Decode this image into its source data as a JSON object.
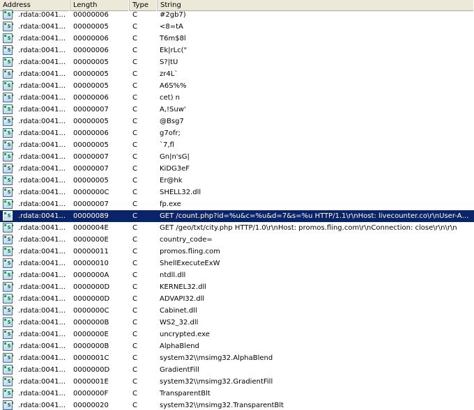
{
  "columns": {
    "address": "Address",
    "length": "Length",
    "type": "Type",
    "string": "String"
  },
  "colors": {
    "header_bg": "#ece9d8",
    "selection_bg": "#0a246a",
    "selection_fg": "#ffffff"
  },
  "icon_name": "string-icon",
  "icon_glyph": "'s'",
  "selected_index": 17,
  "rows": [
    {
      "address": ".rdata:0041...",
      "length": "00000006",
      "type": "C",
      "string": "#2gb7)"
    },
    {
      "address": ".rdata:0041...",
      "length": "00000005",
      "type": "C",
      "string": "<8=tA"
    },
    {
      "address": ".rdata:0041...",
      "length": "00000006",
      "type": "C",
      "string": "T6m$8l"
    },
    {
      "address": ".rdata:0041...",
      "length": "00000006",
      "type": "C",
      "string": "Ek|rLc(\""
    },
    {
      "address": ".rdata:0041...",
      "length": "00000005",
      "type": "C",
      "string": "S?|tU"
    },
    {
      "address": ".rdata:0041...",
      "length": "00000005",
      "type": "C",
      "string": "zr4L`"
    },
    {
      "address": ".rdata:0041...",
      "length": "00000005",
      "type": "C",
      "string": "A6S%%"
    },
    {
      "address": ".rdata:0041...",
      "length": "00000006",
      "type": "C",
      "string": "cet) n"
    },
    {
      "address": ".rdata:0041...",
      "length": "00000007",
      "type": "C",
      "string": "A,!Suw'"
    },
    {
      "address": ".rdata:0041...",
      "length": "00000005",
      "type": "C",
      "string": "@Bsg7"
    },
    {
      "address": ".rdata:0041...",
      "length": "00000006",
      "type": "C",
      "string": "g7ofr;"
    },
    {
      "address": ".rdata:0041...",
      "length": "00000005",
      "type": "C",
      "string": "`7,fl"
    },
    {
      "address": ".rdata:0041...",
      "length": "00000007",
      "type": "C",
      "string": "Gn|n'sG|"
    },
    {
      "address": ".rdata:0041...",
      "length": "00000007",
      "type": "C",
      "string": "KiDG3eF"
    },
    {
      "address": ".rdata:0041...",
      "length": "00000005",
      "type": "C",
      "string": "Er@hk"
    },
    {
      "address": ".rdata:0041...",
      "length": "0000000C",
      "type": "C",
      "string": "SHELL32.dll"
    },
    {
      "address": ".rdata:0041...",
      "length": "00000007",
      "type": "C",
      "string": "fp.exe"
    },
    {
      "address": ".rdata:0041...",
      "length": "00000089",
      "type": "C",
      "string": "GET /count.php?id=%u&c=%u&d=7&s=%u HTTP/1.1\\r\\nHost: livecounter.co\\r\\nUser-Ag..."
    },
    {
      "address": ".rdata:0041...",
      "length": "0000004E",
      "type": "C",
      "string": "GET /geo/txt/city.php HTTP/1.0\\r\\nHost: promos.fling.com\\r\\nConnection: close\\r\\n\\r\\n"
    },
    {
      "address": ".rdata:0041...",
      "length": "0000000E",
      "type": "C",
      "string": "country_code="
    },
    {
      "address": ".rdata:0041...",
      "length": "00000011",
      "type": "C",
      "string": "promos.fling.com"
    },
    {
      "address": ".rdata:0041...",
      "length": "00000010",
      "type": "C",
      "string": "ShellExecuteExW"
    },
    {
      "address": ".rdata:0041...",
      "length": "0000000A",
      "type": "C",
      "string": "ntdll.dll"
    },
    {
      "address": ".rdata:0041...",
      "length": "0000000D",
      "type": "C",
      "string": "KERNEL32.dll"
    },
    {
      "address": ".rdata:0041...",
      "length": "0000000D",
      "type": "C",
      "string": "ADVAPI32.dll"
    },
    {
      "address": ".rdata:0041...",
      "length": "0000000C",
      "type": "C",
      "string": "Cabinet.dll"
    },
    {
      "address": ".rdata:0041...",
      "length": "0000000B",
      "type": "C",
      "string": "WS2_32.dll"
    },
    {
      "address": ".rdata:0041...",
      "length": "0000000E",
      "type": "C",
      "string": "uncrypted.exe"
    },
    {
      "address": ".rdata:0041...",
      "length": "0000000B",
      "type": "C",
      "string": "AlphaBlend"
    },
    {
      "address": ".rdata:0041...",
      "length": "0000001C",
      "type": "C",
      "string": "system32\\\\msimg32.AlphaBlend"
    },
    {
      "address": ".rdata:0041...",
      "length": "0000000D",
      "type": "C",
      "string": "GradientFill"
    },
    {
      "address": ".rdata:0041...",
      "length": "0000001E",
      "type": "C",
      "string": "system32\\\\msimg32.GradientFill"
    },
    {
      "address": ".rdata:0041...",
      "length": "0000000F",
      "type": "C",
      "string": "TransparentBlt"
    },
    {
      "address": ".rdata:0041...",
      "length": "00000020",
      "type": "C",
      "string": "system32\\\\msimg32.TransparentBlt"
    }
  ]
}
